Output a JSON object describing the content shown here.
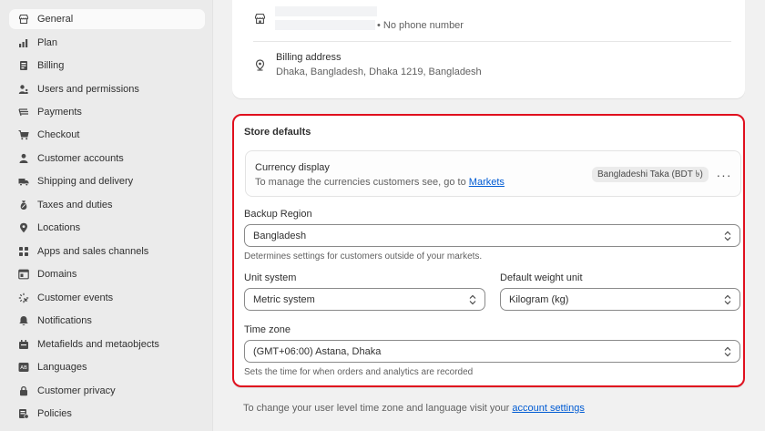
{
  "sidebar": {
    "items": [
      {
        "label": "General",
        "icon": "store-icon"
      },
      {
        "label": "Plan",
        "icon": "plan-icon"
      },
      {
        "label": "Billing",
        "icon": "billing-icon"
      },
      {
        "label": "Users and permissions",
        "icon": "users-icon"
      },
      {
        "label": "Payments",
        "icon": "payments-icon"
      },
      {
        "label": "Checkout",
        "icon": "cart-icon"
      },
      {
        "label": "Customer accounts",
        "icon": "person-icon"
      },
      {
        "label": "Shipping and delivery",
        "icon": "truck-icon"
      },
      {
        "label": "Taxes and duties",
        "icon": "tax-icon"
      },
      {
        "label": "Locations",
        "icon": "location-icon"
      },
      {
        "label": "Apps and sales channels",
        "icon": "apps-icon"
      },
      {
        "label": "Domains",
        "icon": "domains-icon"
      },
      {
        "label": "Customer events",
        "icon": "events-icon"
      },
      {
        "label": "Notifications",
        "icon": "bell-icon"
      },
      {
        "label": "Metafields and metaobjects",
        "icon": "metafields-icon"
      },
      {
        "label": "Languages",
        "icon": "languages-icon"
      },
      {
        "label": "Customer privacy",
        "icon": "lock-icon"
      },
      {
        "label": "Policies",
        "icon": "policies-icon"
      }
    ],
    "active": "General"
  },
  "store_details": {
    "phone_text": "• No phone number",
    "billing_address_label": "Billing address",
    "billing_address_value": "Dhaka, Bangladesh, Dhaka 1219, Bangladesh"
  },
  "store_defaults": {
    "title": "Store defaults",
    "currency": {
      "label": "Currency display",
      "description": "To manage the currencies customers see, go to",
      "link": "Markets",
      "badge": "Bangladeshi Taka (BDT ৳)"
    },
    "backup_region": {
      "label": "Backup Region",
      "value": "Bangladesh",
      "help": "Determines settings for customers outside of your markets."
    },
    "unit_system": {
      "label": "Unit system",
      "value": "Metric system"
    },
    "weight_unit": {
      "label": "Default weight unit",
      "value": "Kilogram (kg)"
    },
    "time_zone": {
      "label": "Time zone",
      "value": "(GMT+06:00) Astana, Dhaka",
      "help": "Sets the time for when orders and analytics are recorded"
    }
  },
  "footer": {
    "text": "To change your user level time zone and language visit your",
    "link": "account settings"
  },
  "colors": {
    "highlight_border": "#e0101e",
    "link": "#005bd3"
  }
}
